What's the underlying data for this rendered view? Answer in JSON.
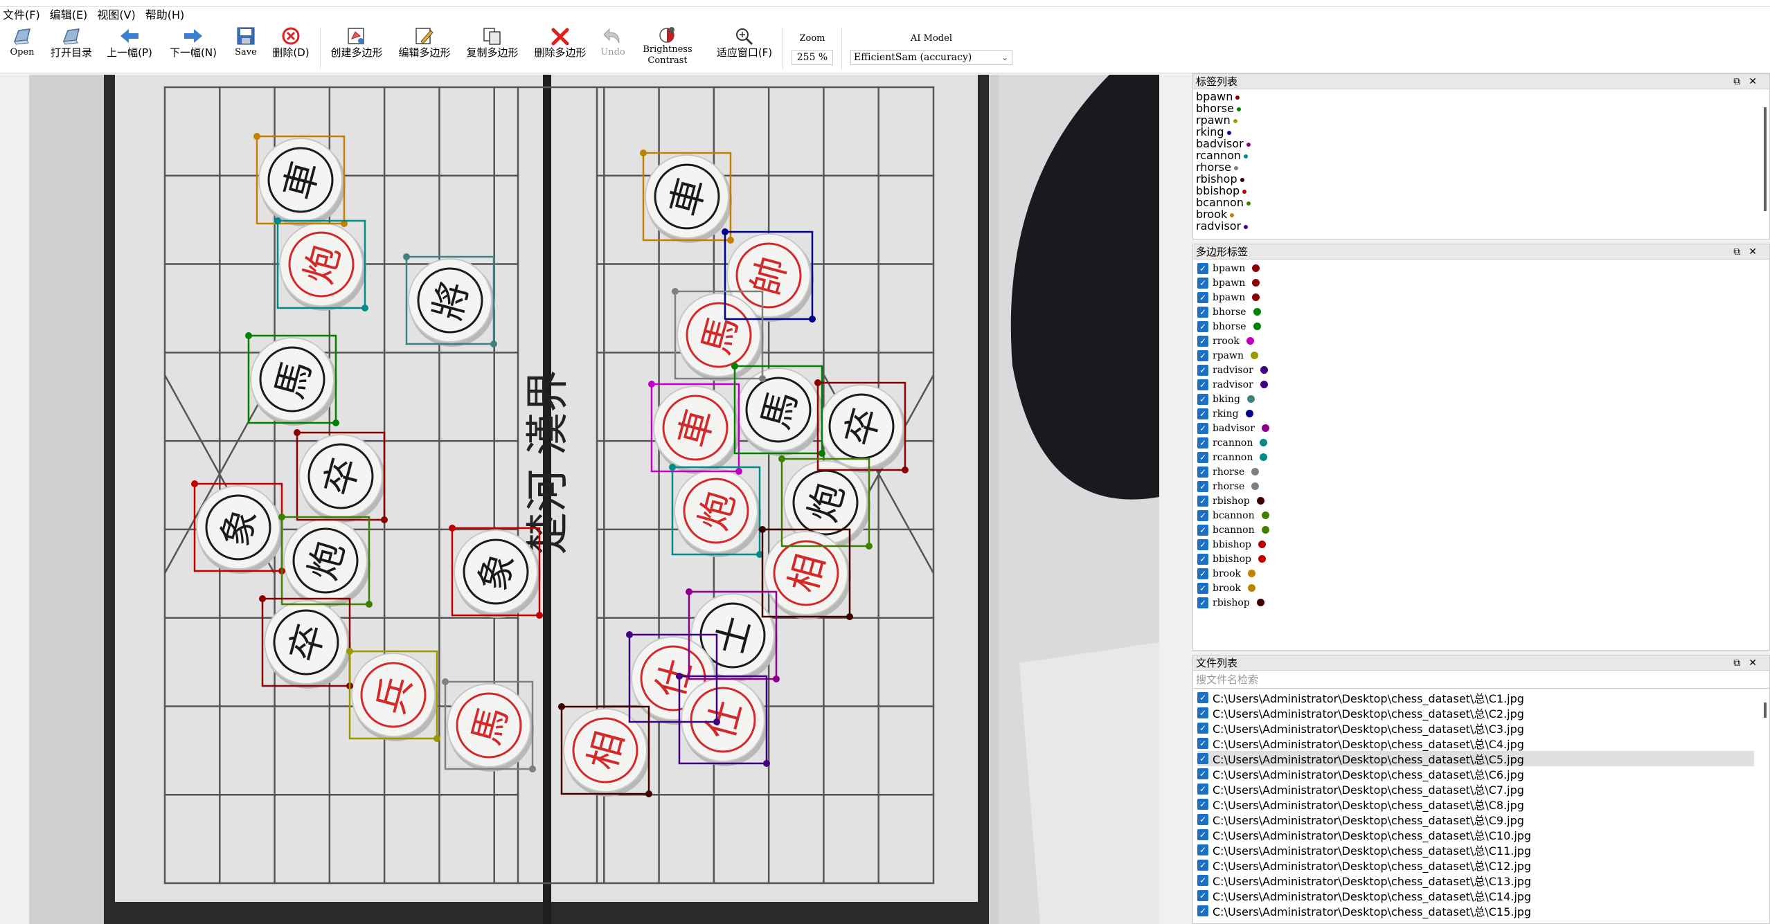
{
  "menus": [
    "文件(F)",
    "编辑(E)",
    "视图(V)",
    "帮助(H)"
  ],
  "toolbar": {
    "open": "Open",
    "open_dir": "打开目录",
    "prev": "上一幅(P)",
    "next": "下一幅(N)",
    "save": "Save",
    "delete": "删除(D)",
    "create_poly": "创建多边形",
    "edit_poly": "编辑多边形",
    "copy_poly": "复制多边形",
    "delete_poly": "删除多边形",
    "undo": "Undo",
    "brightness_line1": "Brightness",
    "brightness_line2": "Contrast",
    "fit_window": "适应窗口(F)",
    "zoom_label": "Zoom",
    "zoom_value": "255 %",
    "ai_label": "AI Model",
    "ai_value": "EfficientSam (accuracy)"
  },
  "label_panel": {
    "title": "标签列表",
    "items": [
      {
        "name": "bpawn",
        "color": "#8b0000"
      },
      {
        "name": "bhorse",
        "color": "#008000"
      },
      {
        "name": "rpawn",
        "color": "#9a9a00"
      },
      {
        "name": "rking",
        "color": "#00008b"
      },
      {
        "name": "badvisor",
        "color": "#8b008b"
      },
      {
        "name": "rcannon",
        "color": "#008b8b"
      },
      {
        "name": "rhorse",
        "color": "#808080"
      },
      {
        "name": "rbishop",
        "color": "#400000"
      },
      {
        "name": "bbishop",
        "color": "#c00000"
      },
      {
        "name": "bcannon",
        "color": "#408000"
      },
      {
        "name": "brook",
        "color": "#c08000"
      },
      {
        "name": "radvisor",
        "color": "#400080"
      }
    ]
  },
  "poly_panel": {
    "title": "多边形标签",
    "items": [
      {
        "name": "bpawn",
        "color": "#8b0000"
      },
      {
        "name": "bpawn",
        "color": "#8b0000"
      },
      {
        "name": "bpawn",
        "color": "#8b0000"
      },
      {
        "name": "bhorse",
        "color": "#008000"
      },
      {
        "name": "bhorse",
        "color": "#008000"
      },
      {
        "name": "rrook",
        "color": "#c000c0"
      },
      {
        "name": "rpawn",
        "color": "#9a9a00"
      },
      {
        "name": "radvisor",
        "color": "#400080"
      },
      {
        "name": "radvisor",
        "color": "#400080"
      },
      {
        "name": "bking",
        "color": "#408080"
      },
      {
        "name": "rking",
        "color": "#00008b"
      },
      {
        "name": "badvisor",
        "color": "#8b008b"
      },
      {
        "name": "rcannon",
        "color": "#008b8b"
      },
      {
        "name": "rcannon",
        "color": "#008b8b"
      },
      {
        "name": "rhorse",
        "color": "#808080"
      },
      {
        "name": "rhorse",
        "color": "#808080"
      },
      {
        "name": "rbishop",
        "color": "#400000"
      },
      {
        "name": "bcannon",
        "color": "#408000"
      },
      {
        "name": "bcannon",
        "color": "#408000"
      },
      {
        "name": "bbishop",
        "color": "#c00000"
      },
      {
        "name": "bbishop",
        "color": "#c00000"
      },
      {
        "name": "brook",
        "color": "#c08000"
      },
      {
        "name": "brook",
        "color": "#c08000"
      },
      {
        "name": "rbishop",
        "color": "#400000"
      }
    ]
  },
  "file_panel": {
    "title": "文件列表",
    "search_placeholder": "搜文件名检索",
    "selected_index": 4,
    "items": [
      "C:\\Users\\Administrator\\Desktop\\chess_dataset\\总\\C1.jpg",
      "C:\\Users\\Administrator\\Desktop\\chess_dataset\\总\\C2.jpg",
      "C:\\Users\\Administrator\\Desktop\\chess_dataset\\总\\C3.jpg",
      "C:\\Users\\Administrator\\Desktop\\chess_dataset\\总\\C4.jpg",
      "C:\\Users\\Administrator\\Desktop\\chess_dataset\\总\\C5.jpg",
      "C:\\Users\\Administrator\\Desktop\\chess_dataset\\总\\C6.jpg",
      "C:\\Users\\Administrator\\Desktop\\chess_dataset\\总\\C7.jpg",
      "C:\\Users\\Administrator\\Desktop\\chess_dataset\\总\\C8.jpg",
      "C:\\Users\\Administrator\\Desktop\\chess_dataset\\总\\C9.jpg",
      "C:\\Users\\Administrator\\Desktop\\chess_dataset\\总\\C10.jpg",
      "C:\\Users\\Administrator\\Desktop\\chess_dataset\\总\\C11.jpg",
      "C:\\Users\\Administrator\\Desktop\\chess_dataset\\总\\C12.jpg",
      "C:\\Users\\Administrator\\Desktop\\chess_dataset\\总\\C13.jpg",
      "C:\\Users\\Administrator\\Desktop\\chess_dataset\\总\\C14.jpg",
      "C:\\Users\\Administrator\\Desktop\\chess_dataset\\总\\C15.jpg"
    ]
  },
  "board": {
    "river_text": "楚河 漢界",
    "pieces": [
      {
        "char": "車",
        "side": "black",
        "box_color": "#c08000"
      },
      {
        "char": "炮",
        "side": "red",
        "box_color": "#008b8b"
      },
      {
        "char": "將",
        "side": "black",
        "box_color": "#408080"
      },
      {
        "char": "馬",
        "side": "black",
        "box_color": "#008000"
      },
      {
        "char": "卒",
        "side": "black",
        "box_color": "#8b0000"
      },
      {
        "char": "象",
        "side": "black",
        "box_color": "#c00000"
      },
      {
        "char": "炮",
        "side": "black",
        "box_color": "#408000"
      },
      {
        "char": "象",
        "side": "black",
        "box_color": "#c00000"
      },
      {
        "char": "卒",
        "side": "black",
        "box_color": "#8b0000"
      },
      {
        "char": "兵",
        "side": "red",
        "box_color": "#9a9a00"
      },
      {
        "char": "馬",
        "side": "red",
        "box_color": "#808080"
      },
      {
        "char": "車",
        "side": "black",
        "box_color": "#c08000"
      },
      {
        "char": "帥",
        "side": "red",
        "box_color": "#00008b"
      },
      {
        "char": "馬",
        "side": "red",
        "box_color": "#808080"
      },
      {
        "char": "車",
        "side": "red",
        "box_color": "#c000c0"
      },
      {
        "char": "馬",
        "side": "black",
        "box_color": "#008000"
      },
      {
        "char": "卒",
        "side": "black",
        "box_color": "#8b0000"
      },
      {
        "char": "炮",
        "side": "red",
        "box_color": "#008b8b"
      },
      {
        "char": "炮",
        "side": "black",
        "box_color": "#408000"
      },
      {
        "char": "相",
        "side": "red",
        "box_color": "#400000"
      },
      {
        "char": "士",
        "side": "black",
        "box_color": "#8b008b"
      },
      {
        "char": "仕",
        "side": "red",
        "box_color": "#400080"
      },
      {
        "char": "仕",
        "side": "red",
        "box_color": "#400080"
      },
      {
        "char": "相",
        "side": "red",
        "box_color": "#400000"
      }
    ]
  }
}
